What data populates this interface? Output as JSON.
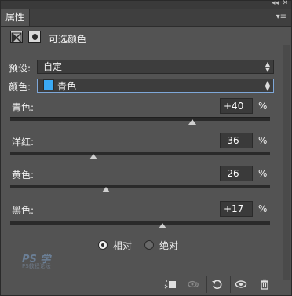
{
  "panel": {
    "tab_label": "属性",
    "title": "可选颜色"
  },
  "preset": {
    "label": "预设:",
    "value": "自定"
  },
  "color": {
    "label": "颜色:",
    "value": "青色",
    "swatch_color": "#3aa9f4"
  },
  "sliders": [
    {
      "label": "青色:",
      "value": "+40",
      "unit": "%",
      "amount": 40
    },
    {
      "label": "洋红:",
      "value": "-36",
      "unit": "%",
      "amount": -36
    },
    {
      "label": "黄色:",
      "value": "-26",
      "unit": "%",
      "amount": -26
    },
    {
      "label": "黑色:",
      "value": "+17",
      "unit": "%",
      "amount": 17
    }
  ],
  "mode": {
    "relative_label": "相对",
    "absolute_label": "绝对",
    "selected": "relative"
  },
  "watermark": {
    "text": "PS 学",
    "sub": "PS教程论坛"
  },
  "icons": {
    "collapse": "double-chevron-icon",
    "close": "close-icon",
    "menu": "panel-menu-icon",
    "adjustment": "adjustment-layer-icon",
    "mask": "mask-icon",
    "clip": "clip-to-layer-icon",
    "view_previous": "view-previous-icon",
    "reset": "reset-icon",
    "visibility": "eye-icon",
    "delete": "trash-icon"
  }
}
